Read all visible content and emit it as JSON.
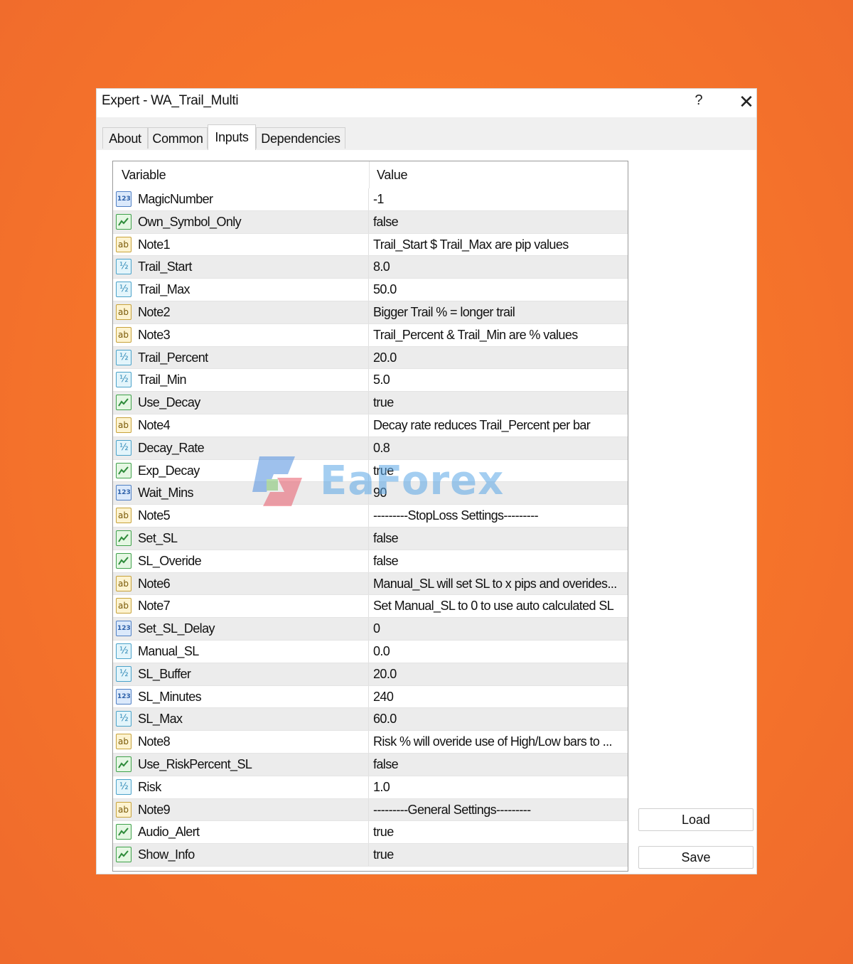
{
  "window": {
    "title": "Expert - WA_Trail_Multi",
    "help": "?",
    "close": "✕"
  },
  "tabs": [
    "About",
    "Common",
    "Inputs",
    "Dependencies"
  ],
  "active_tab": "Inputs",
  "table": {
    "headers": {
      "variable": "Variable",
      "value": "Value"
    },
    "rows": [
      {
        "type": "int",
        "name": "MagicNumber",
        "value": "-1"
      },
      {
        "type": "bool",
        "name": "Own_Symbol_Only",
        "value": "false"
      },
      {
        "type": "string",
        "name": "Note1",
        "value": "Trail_Start $ Trail_Max are pip values"
      },
      {
        "type": "double",
        "name": "Trail_Start",
        "value": "8.0"
      },
      {
        "type": "double",
        "name": "Trail_Max",
        "value": "50.0"
      },
      {
        "type": "string",
        "name": "Note2",
        "value": "Bigger Trail % = longer trail"
      },
      {
        "type": "string",
        "name": "Note3",
        "value": "Trail_Percent & Trail_Min are % values"
      },
      {
        "type": "double",
        "name": "Trail_Percent",
        "value": "20.0"
      },
      {
        "type": "double",
        "name": "Trail_Min",
        "value": "5.0"
      },
      {
        "type": "bool",
        "name": "Use_Decay",
        "value": "true"
      },
      {
        "type": "string",
        "name": "Note4",
        "value": "Decay rate reduces Trail_Percent per bar"
      },
      {
        "type": "double",
        "name": "Decay_Rate",
        "value": "0.8"
      },
      {
        "type": "bool",
        "name": "Exp_Decay",
        "value": "true"
      },
      {
        "type": "int",
        "name": "Wait_Mins",
        "value": "90"
      },
      {
        "type": "string",
        "name": "Note5",
        "value": "---------StopLoss Settings---------"
      },
      {
        "type": "bool",
        "name": "Set_SL",
        "value": "false"
      },
      {
        "type": "bool",
        "name": "SL_Overide",
        "value": "false"
      },
      {
        "type": "string",
        "name": "Note6",
        "value": "Manual_SL will set SL to x pips and overides..."
      },
      {
        "type": "string",
        "name": "Note7",
        "value": "Set Manual_SL to 0 to use auto calculated SL"
      },
      {
        "type": "int",
        "name": "Set_SL_Delay",
        "value": "0"
      },
      {
        "type": "double",
        "name": "Manual_SL",
        "value": "0.0"
      },
      {
        "type": "double",
        "name": "SL_Buffer",
        "value": "20.0"
      },
      {
        "type": "int",
        "name": "SL_Minutes",
        "value": "240"
      },
      {
        "type": "double",
        "name": "SL_Max",
        "value": "60.0"
      },
      {
        "type": "string",
        "name": "Note8",
        "value": "Risk % will overide use of High/Low bars to ..."
      },
      {
        "type": "bool",
        "name": "Use_RiskPercent_SL",
        "value": "false"
      },
      {
        "type": "double",
        "name": "Risk",
        "value": "1.0"
      },
      {
        "type": "string",
        "name": "Note9",
        "value": "---------General Settings---------"
      },
      {
        "type": "bool",
        "name": "Audio_Alert",
        "value": "true"
      },
      {
        "type": "bool",
        "name": "Show_Info",
        "value": "true"
      }
    ]
  },
  "buttons": {
    "load": "Load",
    "save": "Save"
  },
  "watermark": {
    "text": "EaForex"
  }
}
